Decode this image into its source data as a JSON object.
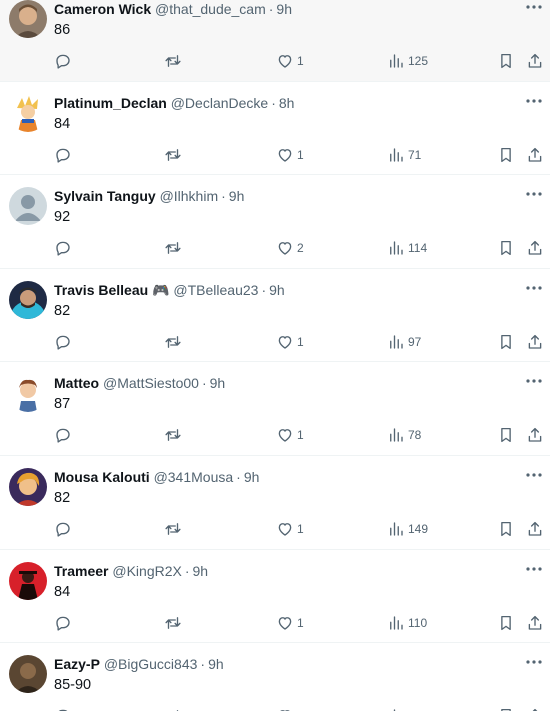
{
  "icons": {
    "reply": "reply-icon",
    "retweet": "retweet-icon",
    "like": "like-icon",
    "views": "views-icon",
    "bookmark": "bookmark-icon",
    "share": "share-icon",
    "more": "more-icon"
  },
  "colors": {
    "name": "#0f1419",
    "muted": "#536471",
    "divider": "#eff3f4",
    "hover_background": "#f7f7f7"
  },
  "separator": "·",
  "tweets": [
    {
      "name": "Cameron Wick",
      "handle": "@that_dude_cam",
      "time": "9h",
      "text": "86",
      "likes": "1",
      "views": "125"
    },
    {
      "name": "Platinum_Declan",
      "handle": "@DeclanDecke",
      "time": "8h",
      "text": "84",
      "likes": "1",
      "views": "71"
    },
    {
      "name": "Sylvain Tanguy",
      "handle": "@Ilhkhim",
      "time": "9h",
      "text": "92",
      "likes": "2",
      "views": "114"
    },
    {
      "name": "Travis Belleau 🎮",
      "handle": "@TBelleau23",
      "time": "9h",
      "text": "82",
      "likes": "1",
      "views": "97"
    },
    {
      "name": "Matteo",
      "handle": "@MattSiesto00",
      "time": "9h",
      "text": "87",
      "likes": "1",
      "views": "78"
    },
    {
      "name": "Mousa Kalouti",
      "handle": "@341Mousa",
      "time": "9h",
      "text": "82",
      "likes": "1",
      "views": "149"
    },
    {
      "name": "Trameer",
      "handle": "@KingR2X",
      "time": "9h",
      "text": "84",
      "likes": "1",
      "views": "110"
    },
    {
      "name": "Eazy-P",
      "handle": "@BigGucci843",
      "time": "9h",
      "text": "85-90",
      "likes": "",
      "views": ""
    }
  ]
}
